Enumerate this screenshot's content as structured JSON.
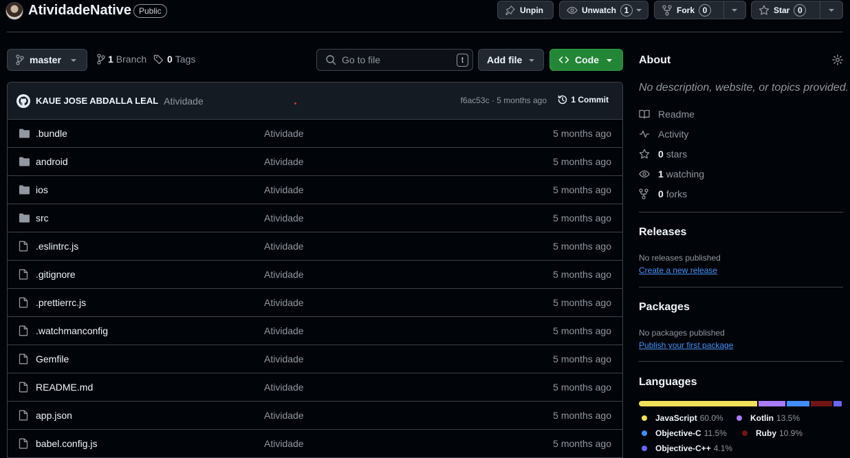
{
  "repo": {
    "name": "AtividadeNative",
    "visibility": "Public"
  },
  "actions": {
    "unpin": "Unpin",
    "watch": {
      "label": "Unwatch",
      "count": "1"
    },
    "fork": {
      "label": "Fork",
      "count": "0"
    },
    "star": {
      "label": "Star",
      "count": "0"
    }
  },
  "toolbar": {
    "branch": "master",
    "branches": {
      "count": "1",
      "label": "Branch"
    },
    "tags": {
      "count": "0",
      "label": "Tags"
    },
    "search_placeholder": "Go to file",
    "search_kbd": "t",
    "add_file": "Add file",
    "code": "Code"
  },
  "commit": {
    "author": "KAUE JOSE ABDALLA LEAL",
    "message": "Atividade",
    "meta": "f6ac53c · 5 months ago",
    "count_label": "1 Commit"
  },
  "files": [
    {
      "type": "dir",
      "name": ".bundle",
      "message": "Atividade",
      "date": "5 months ago"
    },
    {
      "type": "dir",
      "name": "android",
      "message": "Atividade",
      "date": "5 months ago"
    },
    {
      "type": "dir",
      "name": "ios",
      "message": "Atividade",
      "date": "5 months ago"
    },
    {
      "type": "dir",
      "name": "src",
      "message": "Atividade",
      "date": "5 months ago"
    },
    {
      "type": "file",
      "name": ".eslintrc.js",
      "message": "Atividade",
      "date": "5 months ago"
    },
    {
      "type": "file",
      "name": ".gitignore",
      "message": "Atividade",
      "date": "5 months ago"
    },
    {
      "type": "file",
      "name": ".prettierrc.js",
      "message": "Atividade",
      "date": "5 months ago"
    },
    {
      "type": "file",
      "name": ".watchmanconfig",
      "message": "Atividade",
      "date": "5 months ago"
    },
    {
      "type": "file",
      "name": "Gemfile",
      "message": "Atividade",
      "date": "5 months ago"
    },
    {
      "type": "file",
      "name": "README.md",
      "message": "Atividade",
      "date": "5 months ago"
    },
    {
      "type": "file",
      "name": "app.json",
      "message": "Atividade",
      "date": "5 months ago"
    },
    {
      "type": "file",
      "name": "babel.config.js",
      "message": "Atividade",
      "date": "5 months ago"
    }
  ],
  "about": {
    "title": "About",
    "description": "No description, website, or topics provided.",
    "items": [
      {
        "icon": "book-icon",
        "count": "",
        "label": "Readme"
      },
      {
        "icon": "pulse-icon",
        "count": "",
        "label": "Activity"
      },
      {
        "icon": "star-icon",
        "count": "0",
        "label": "stars"
      },
      {
        "icon": "eye-icon",
        "count": "1",
        "label": "watching"
      },
      {
        "icon": "repo-forked-icon",
        "count": "0",
        "label": "forks"
      }
    ]
  },
  "releases": {
    "title": "Releases",
    "text": "No releases published",
    "link": "Create a new release"
  },
  "packages": {
    "title": "Packages",
    "text": "No packages published",
    "link": "Publish your first package"
  },
  "languages": {
    "title": "Languages",
    "items": [
      {
        "name": "JavaScript",
        "percent": "60.0%",
        "value": 60.0,
        "color": "#f1e05a"
      },
      {
        "name": "Kotlin",
        "percent": "13.5%",
        "value": 13.5,
        "color": "#a97bff"
      },
      {
        "name": "Objective-C",
        "percent": "11.5%",
        "value": 11.5,
        "color": "#438eff"
      },
      {
        "name": "Ruby",
        "percent": "10.9%",
        "value": 10.9,
        "color": "#701516"
      },
      {
        "name": "Objective-C++",
        "percent": "4.1%",
        "value": 4.1,
        "color": "#6866fb"
      }
    ]
  },
  "colors": {
    "accent": "#4493f8",
    "code_button": "#238636"
  }
}
